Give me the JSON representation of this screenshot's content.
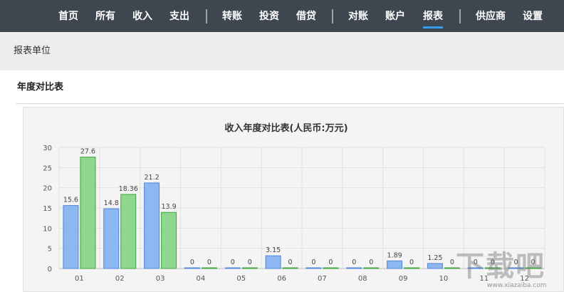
{
  "nav": {
    "items": [
      {
        "label": "首页"
      },
      {
        "label": "所有"
      },
      {
        "label": "收入"
      },
      {
        "label": "支出"
      },
      {
        "label": "转账"
      },
      {
        "label": "投资"
      },
      {
        "label": "借贷"
      },
      {
        "label": "对账"
      },
      {
        "label": "账户"
      },
      {
        "label": "报表"
      },
      {
        "label": "供应商"
      },
      {
        "label": "设置"
      }
    ],
    "active": "报表",
    "active_color": "#2e9bf0"
  },
  "unit_bar": {
    "label": "报表单位"
  },
  "section": {
    "title": "年度对比表"
  },
  "chart_data": {
    "type": "bar",
    "title": "收入年度对比表(人民币:万元)",
    "xlabel": "",
    "ylabel": "",
    "categories": [
      "01",
      "02",
      "03",
      "04",
      "05",
      "06",
      "07",
      "08",
      "09",
      "10",
      "11",
      "12"
    ],
    "series": [
      {
        "values": [
          15.6,
          14.8,
          21.2,
          0,
          0,
          3.15,
          0,
          0,
          1.89,
          1.25,
          0,
          0
        ],
        "color": "#8db7f0",
        "stroke": "#4f86d6"
      },
      {
        "values": [
          27.6,
          18.36,
          13.9,
          0,
          0,
          0,
          0,
          0,
          0,
          0,
          0,
          0
        ],
        "color": "#8fd68f",
        "stroke": "#3fa53f"
      }
    ],
    "data_labels": [
      [
        "15.6",
        "14.8",
        "21.2",
        "0",
        "0",
        "3.15",
        "0",
        "0",
        "1.89",
        "1.25",
        "0",
        "0"
      ],
      [
        "27.6",
        "18.36",
        "13.9",
        "0",
        "0",
        "0",
        "0",
        "0",
        "0",
        "0",
        "0",
        "0"
      ]
    ],
    "ylim": [
      0,
      30
    ],
    "yticks": [
      "0",
      "5",
      "10",
      "15",
      "20",
      "25",
      "30"
    ],
    "grid": true,
    "legend": "none"
  },
  "watermark": {
    "text": "下载吧",
    "url": "www.xiazaiba.com"
  }
}
